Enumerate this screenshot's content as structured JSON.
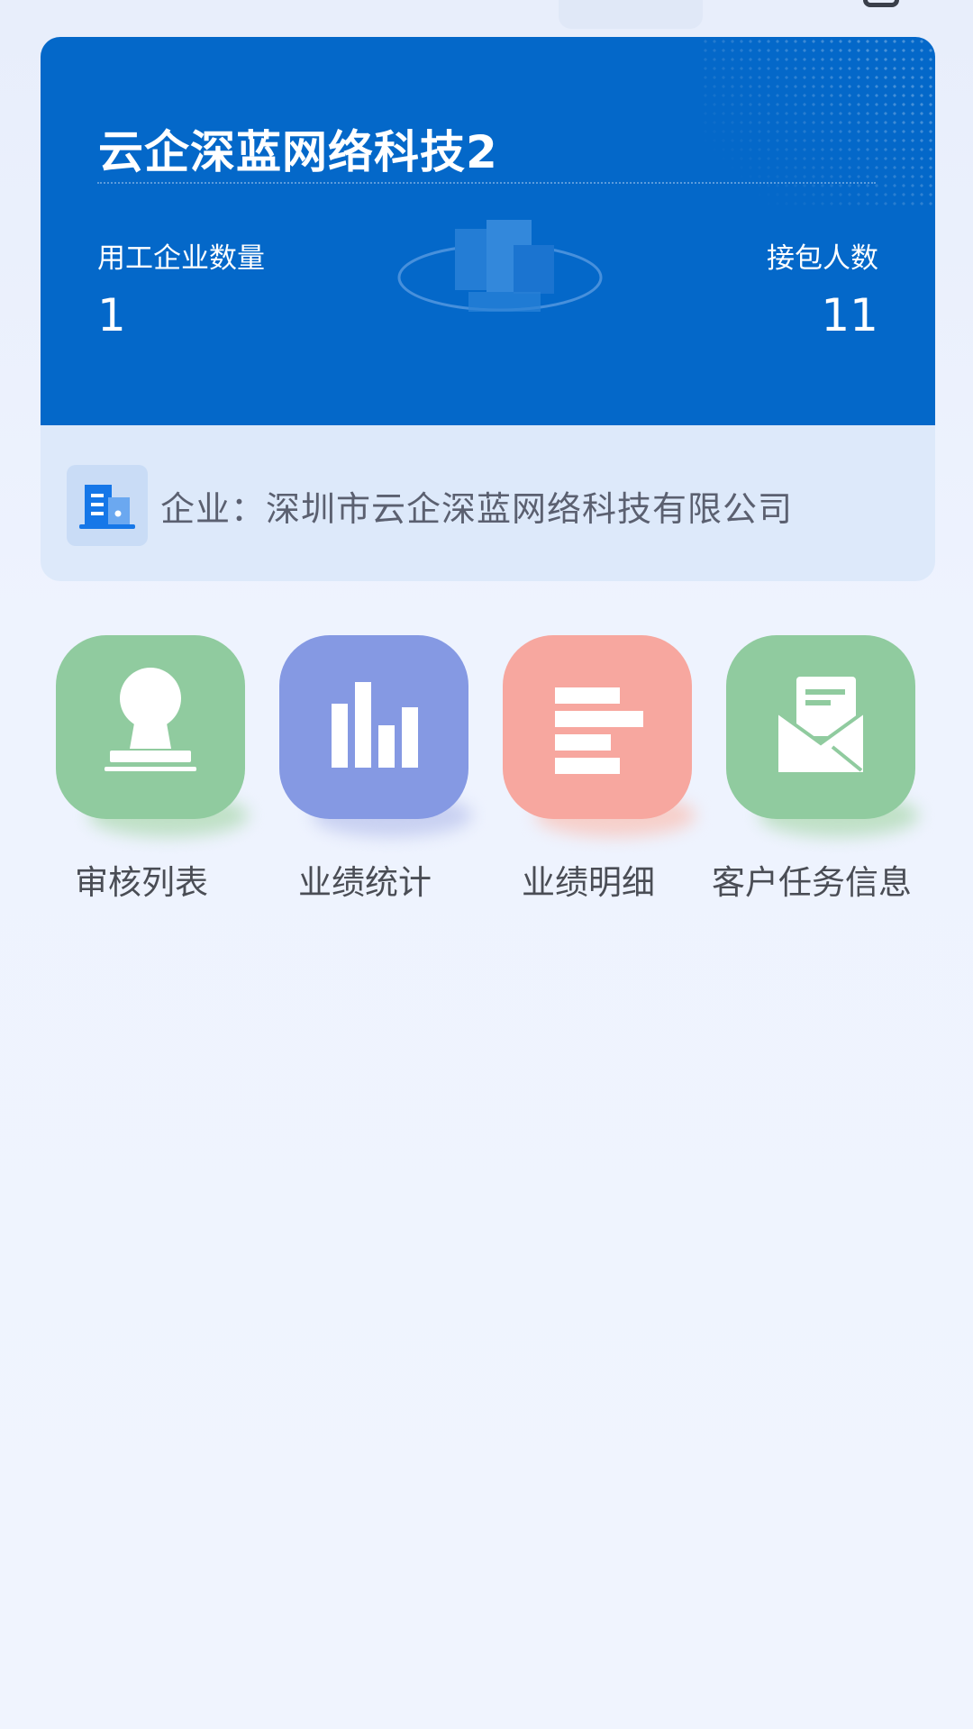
{
  "card": {
    "title": "云企深蓝网络科技2",
    "stats": {
      "left": {
        "label": "用工企业数量",
        "value": "1"
      },
      "right": {
        "label": "接包人数",
        "value": "11"
      }
    },
    "company_label": "企业：深圳市云企深蓝网络科技有限公司"
  },
  "menu": {
    "items": [
      {
        "label": "审核列表",
        "icon": "stamp-icon",
        "color": "#90cb9f"
      },
      {
        "label": "业绩统计",
        "icon": "bar-chart-icon",
        "color": "#8599e3"
      },
      {
        "label": "业绩明细",
        "icon": "list-bars-icon",
        "color": "#f7a79f"
      },
      {
        "label": "客户任务信息",
        "icon": "envelope-icon",
        "color": "#90cb9f"
      }
    ]
  },
  "colors": {
    "card_blue": "#0468c9",
    "card_light": "#dde9fa",
    "background": "#eef3fe"
  }
}
